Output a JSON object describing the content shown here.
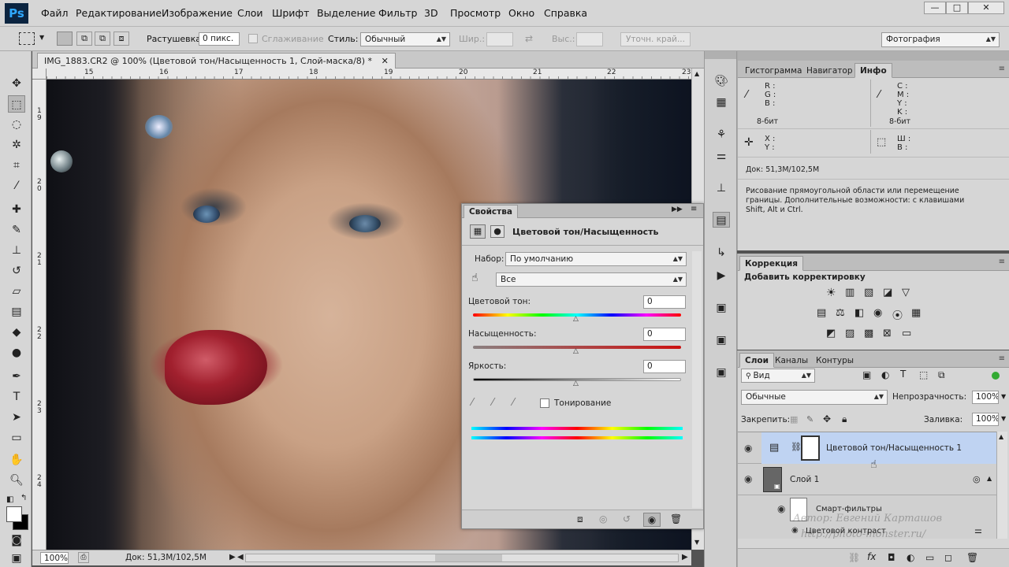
{
  "app": {
    "logo": "Ps"
  },
  "menu": [
    "Файл",
    "Редактирование",
    "Изображение",
    "Слои",
    "Шрифт",
    "Выделение",
    "Фильтр",
    "3D",
    "Просмотр",
    "Окно",
    "Справка"
  ],
  "window_controls": {
    "minimize": "—",
    "restore": "□",
    "close": "✕"
  },
  "options": {
    "feather_label": "Растушевка:",
    "feather_value": "0 пикс.",
    "antialias_label": "Сглаживание",
    "style_label": "Стиль:",
    "style_value": "Обычный",
    "width_label": "Шир.:",
    "height_label": "Выс.:",
    "refine_edge": "Уточн. край...",
    "workspace": "Фотография"
  },
  "document": {
    "tab_title": "IMG_1883.CR2 @ 100% (Цветовой тон/Насыщенность 1, Слой-маска/8) *",
    "close": "✕",
    "zoom": "100%",
    "doc_size": "Док: 51,3M/102,5M"
  },
  "ruler": {
    "h": [
      "15",
      "16",
      "17",
      "18",
      "19",
      "20",
      "21",
      "22",
      "23"
    ],
    "v": [
      "1 9",
      "2 0",
      "2 1",
      "2 2",
      "2 3",
      "2 4"
    ]
  },
  "properties": {
    "title": "Свойства",
    "adjustment_name": "Цветовой тон/Насыщенность",
    "preset_label": "Набор:",
    "preset_value": "По умолчанию",
    "channel_value": "Все",
    "hue_label": "Цветовой тон:",
    "hue_value": "0",
    "saturation_label": "Насыщенность:",
    "saturation_value": "0",
    "lightness_label": "Яркость:",
    "lightness_value": "0",
    "colorize_label": "Тонирование"
  },
  "info_panel": {
    "tabs": [
      "Гистограмма",
      "Навигатор",
      "Инфо"
    ],
    "rgb": [
      "R :",
      "G :",
      "B :"
    ],
    "cmyk": [
      "C :",
      "M :",
      "Y :",
      "K :"
    ],
    "bits_left": "8-бит",
    "bits_right": "8-бит",
    "xy": [
      "X :",
      "Y :"
    ],
    "wh": [
      "Ш :",
      "В :"
    ],
    "doc": "Док: 51,3M/102,5M",
    "hint": "Рисование прямоугольной области или перемещение границы. Дополнительные возможности: с клавишами Shift, Alt и Ctrl."
  },
  "adjustments": {
    "tab": "Коррекция",
    "title": "Добавить корректировку"
  },
  "layers": {
    "tabs": [
      "Слои",
      "Каналы",
      "Контуры"
    ],
    "filter": "Вид",
    "blend": "Обычные",
    "opacity_label": "Непрозрачность:",
    "opacity_value": "100%",
    "lock_label": "Закрепить:",
    "fill_label": "Заливка:",
    "fill_value": "100%",
    "items": [
      {
        "name": "Цветовой тон/Насыщенность 1",
        "selected": true
      },
      {
        "name": "Слой 1",
        "selected": false
      },
      {
        "name": "Смарт-фильтры",
        "selected": false
      },
      {
        "name": "Цветовой контраст",
        "selected": false
      }
    ]
  },
  "watermark": {
    "line1": "Автор: Евгений Карташов",
    "line2": "http://photo-monster.ru/"
  },
  "colors": {
    "selected_layer": "#bfd3f2",
    "accent_blue": "#2fa8ff"
  }
}
